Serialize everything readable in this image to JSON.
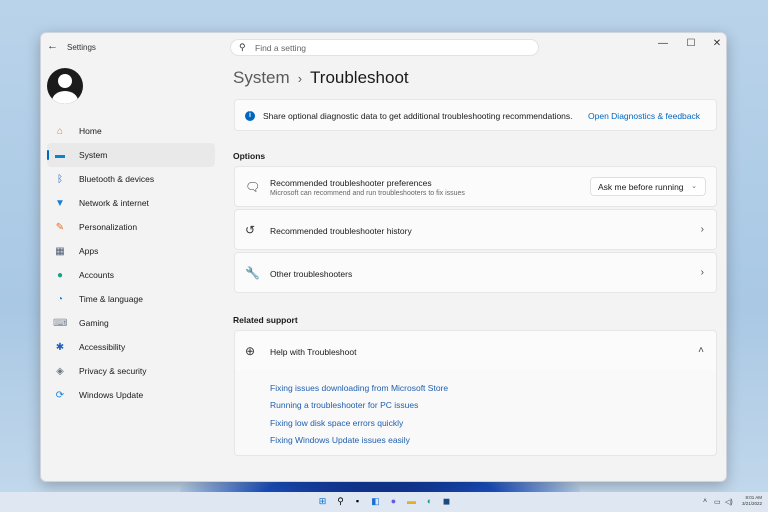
{
  "window": {
    "title": "Settings",
    "minimize": "—",
    "maximize": "☐",
    "close": "✕",
    "back": "←"
  },
  "search": {
    "placeholder": "Find a setting",
    "icon": "search-icon"
  },
  "breadcrumb": {
    "parent": "System",
    "separator": "›",
    "current": "Troubleshoot"
  },
  "sidebar": {
    "items": [
      {
        "label": "Home",
        "icon": "home-icon",
        "glyph": "⌂",
        "color": "#e07a2a"
      },
      {
        "label": "System",
        "icon": "system-icon",
        "glyph": "▬",
        "color": "#0a84d0",
        "selected": true
      },
      {
        "label": "Bluetooth & devices",
        "icon": "bluetooth-icon",
        "glyph": "ᛒ",
        "color": "#1a6fe0"
      },
      {
        "label": "Network & internet",
        "icon": "wifi-icon",
        "glyph": "▼",
        "color": "#1a7fd8"
      },
      {
        "label": "Personalization",
        "icon": "brush-icon",
        "glyph": "✎",
        "color": "#e0702a"
      },
      {
        "label": "Apps",
        "icon": "apps-icon",
        "glyph": "▦",
        "color": "#4a5a70"
      },
      {
        "label": "Accounts",
        "icon": "accounts-icon",
        "glyph": "●",
        "color": "#20a080"
      },
      {
        "label": "Time & language",
        "icon": "globe-clock-icon",
        "glyph": "◔",
        "color": "#1a80d0"
      },
      {
        "label": "Gaming",
        "icon": "gamepad-icon",
        "glyph": "⌨",
        "color": "#7a8896"
      },
      {
        "label": "Accessibility",
        "icon": "accessibility-icon",
        "glyph": "✱",
        "color": "#1a60c0"
      },
      {
        "label": "Privacy & security",
        "icon": "shield-icon",
        "glyph": "◈",
        "color": "#6a7480"
      },
      {
        "label": "Windows Update",
        "icon": "update-icon",
        "glyph": "⟳",
        "color": "#1a7fd8"
      }
    ]
  },
  "info_bar": {
    "text": "Share optional diagnostic data to get additional troubleshooting recommendations.",
    "link": "Open Diagnostics & feedback",
    "icon": "i"
  },
  "options": {
    "heading": "Options",
    "rows": [
      {
        "title": "Recommended troubleshooter preferences",
        "subtitle": "Microsoft can recommend and run troubleshooters to fix issues",
        "icon": "chat-icon",
        "glyph": "🗨",
        "dropdown": "Ask me before running"
      },
      {
        "title": "Recommended troubleshooter history",
        "icon": "history-icon",
        "glyph": "↺",
        "chevron": "›"
      },
      {
        "title": "Other troubleshooters",
        "icon": "wrench-icon",
        "glyph": "🔧",
        "chevron": "›"
      }
    ]
  },
  "related": {
    "heading": "Related support",
    "title": "Help with Troubleshoot",
    "icon": "globe-icon",
    "glyph": "⊕",
    "chevron": "˄",
    "links": [
      "Fixing issues downloading from Microsoft Store",
      "Running a troubleshooter for PC issues",
      "Fixing low disk space errors quickly",
      "Fixing Windows Update issues easily"
    ]
  },
  "taskbar": {
    "time": "8:01 AM",
    "date": "3/21/2022",
    "tray_chevron": "˄",
    "accent": "#0067c0"
  }
}
